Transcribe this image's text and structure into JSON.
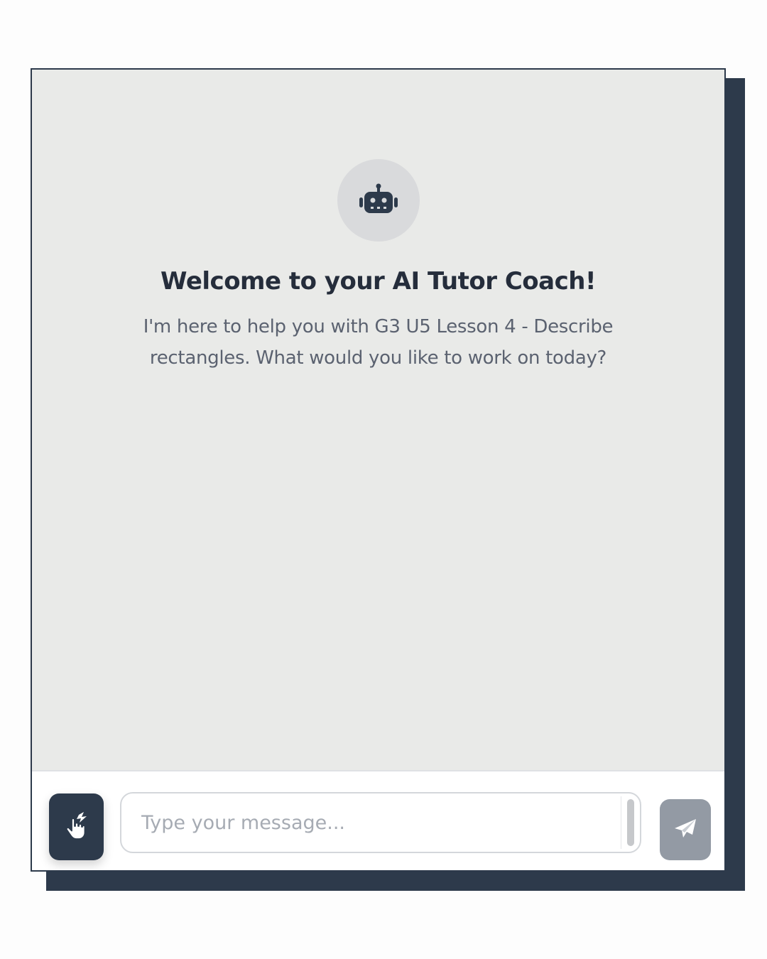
{
  "welcome": {
    "avatar_icon": "robot-icon",
    "title": "Welcome to your AI Tutor Coach!",
    "message": "I'm here to help you with G3 U5 Lesson 4 - Describe rectangles. What would you like to work on today?"
  },
  "composer": {
    "quick_action_icon": "hand-pointer-icon",
    "input_value": "",
    "input_placeholder": "Type your message...",
    "send_icon": "paper-plane-icon"
  },
  "colors": {
    "primary": "#2d3a4b",
    "chat_background": "#e9eae8",
    "send_disabled": "#939aa4",
    "title_text": "#252d3b",
    "body_text": "#5b6270"
  }
}
